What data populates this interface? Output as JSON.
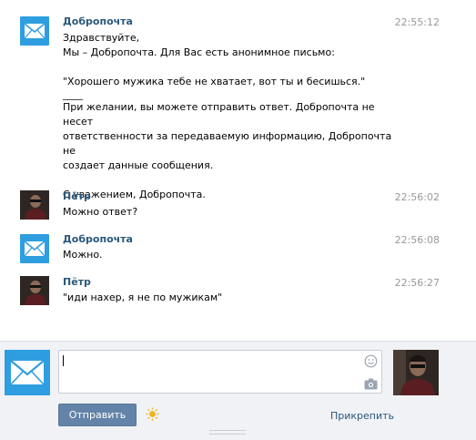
{
  "messages": [
    {
      "author": "Добропочта",
      "time": "22:55:12",
      "avatar": "mail-icon",
      "lines": [
        "Здравствуйте,",
        "Мы – Добропочта. Для Вас есть анонимное письмо:",
        "",
        "\"Хорошего мужика тебе не хватает, вот ты и бесишься.\"",
        "____",
        "При желании, вы можете отправить ответ. Добропочта не несет",
        "ответственности за передаваемую информацию, Добропочта не",
        "создает данные сообщения.",
        "",
        "С уважением, Добропочта."
      ]
    },
    {
      "author": "Пётр",
      "time": "22:56:02",
      "avatar": "user-photo",
      "lines": [
        "Можно ответ?"
      ]
    },
    {
      "author": "Добропочта",
      "time": "22:56:08",
      "avatar": "mail-icon",
      "lines": [
        "Можно."
      ]
    },
    {
      "author": "Пётр",
      "time": "22:56:27",
      "avatar": "user-photo",
      "lines": [
        "\"иди нахер, я не по мужикам\""
      ]
    }
  ],
  "composer": {
    "input_value": "",
    "send_label": "Отправить",
    "attach_label": "Прикрепить"
  },
  "colors": {
    "author": "#2b587a",
    "time": "#999999",
    "mail_blue": "#2f9ee0",
    "send_button": "#6383a8",
    "composer_bg": "#f0f2f5"
  }
}
